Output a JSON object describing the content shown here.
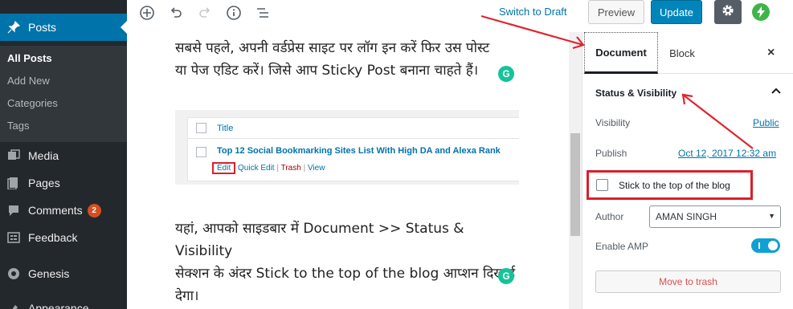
{
  "sidebar": {
    "items": [
      {
        "label": "Posts",
        "icon": "pin-icon"
      },
      {
        "label": "Media",
        "icon": "media-icon"
      },
      {
        "label": "Pages",
        "icon": "pages-icon"
      },
      {
        "label": "Comments",
        "icon": "comment-icon",
        "badge": "2"
      },
      {
        "label": "Feedback",
        "icon": "feedback-icon"
      },
      {
        "label": "Genesis",
        "icon": "genesis-icon"
      },
      {
        "label": "Appearance",
        "icon": "appearance-icon"
      }
    ],
    "submenu": [
      "All Posts",
      "Add New",
      "Categories",
      "Tags"
    ]
  },
  "toolbar": {
    "switch_to_draft": "Switch to Draft",
    "preview": "Preview",
    "update": "Update",
    "icons": [
      "add-block-icon",
      "undo-icon",
      "redo-icon",
      "info-icon",
      "outline-icon",
      "gear-icon",
      "amp-bolt-icon"
    ]
  },
  "content": {
    "para1_line1": "सबसे पहले, अपनी वर्डप्रेस साइट पर लॉग इन करें फिर उस पोस्ट",
    "para1_line2": "या पेज एडिट करें। जिसे आप Sticky Post बनाना चाहते हैं।",
    "shot": {
      "header": "Title",
      "post_title": "Top 12 Social Bookmarking Sites List With High DA and Alexa Rank",
      "actions": {
        "edit": "Edit",
        "quick_edit": "Quick Edit",
        "trash": "Trash",
        "view": "View",
        "sep": "|"
      }
    },
    "para2_line1": "यहां, आपको साइडबार में Document >> Status & Visibility",
    "para2_line2": "सेक्शन के अंदर Stick to the top of the blog आप्शन दिखाई",
    "para2_line3": "देगा।",
    "grammarly_letter": "G"
  },
  "settings": {
    "tabs": {
      "document": "Document",
      "block": "Block"
    },
    "close": "×",
    "panel_title": "Status & Visibility",
    "visibility_label": "Visibility",
    "visibility_value": "Public",
    "publish_label": "Publish",
    "publish_value": "Oct 12, 2017 12:32 am",
    "sticky_label": "Stick to the top of the blog",
    "sticky_checked": false,
    "author_label": "Author",
    "author_value": "AMAN SINGH",
    "amp_label": "Enable AMP",
    "amp_enabled": true,
    "trash_button": "Move to trash"
  },
  "colors": {
    "admin_bg": "#23282d",
    "active": "#0073aa",
    "update": "#0085ba",
    "annotation": "#d9202b",
    "badge": "#d54e21"
  }
}
